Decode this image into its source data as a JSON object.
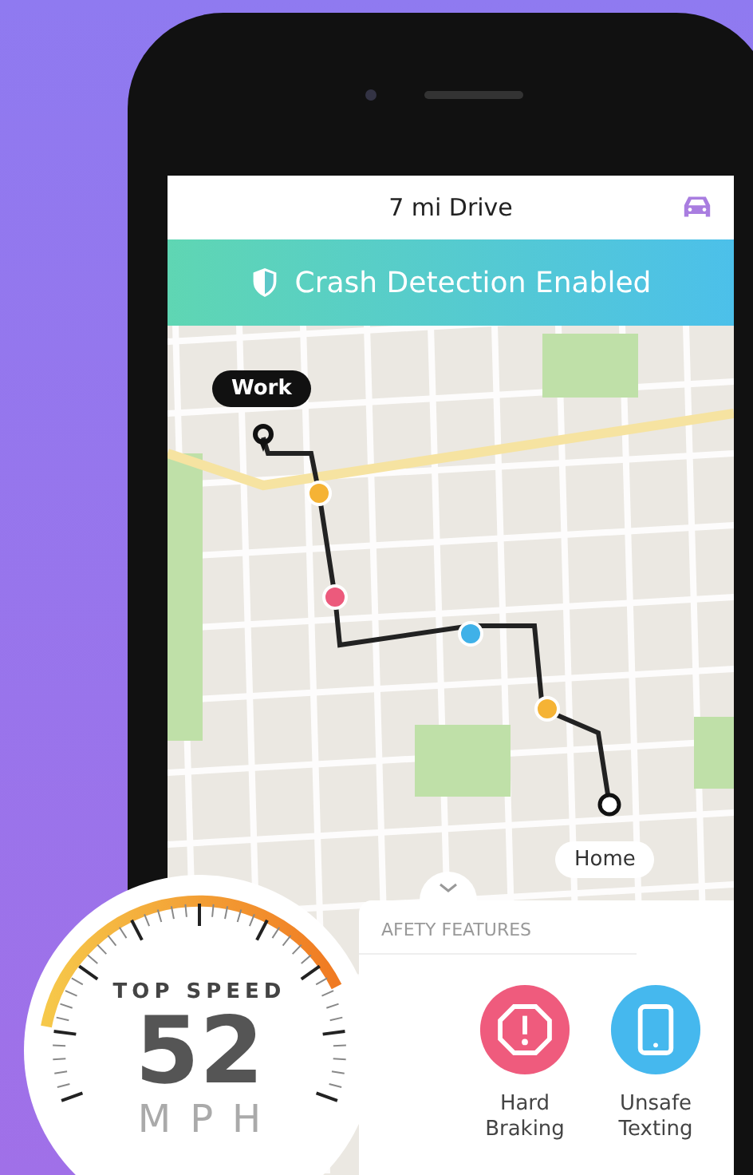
{
  "header": {
    "title": "7 mi Drive"
  },
  "banner": {
    "text": "Crash Detection Enabled"
  },
  "map": {
    "start_label": "Work",
    "end_label": "Home",
    "events": [
      {
        "color": "#f5b335"
      },
      {
        "color": "#ec5a7c"
      },
      {
        "color": "#3fb1e8"
      },
      {
        "color": "#f5b335"
      }
    ]
  },
  "safety_panel": {
    "heading": "AFETY FEATURES",
    "features": [
      {
        "kind": "braking",
        "label": "Hard Braking"
      },
      {
        "kind": "texting",
        "label": "Unsafe Texting"
      }
    ]
  },
  "top_speed": {
    "label": "TOP SPEED",
    "value": "52",
    "unit": "MPH"
  }
}
